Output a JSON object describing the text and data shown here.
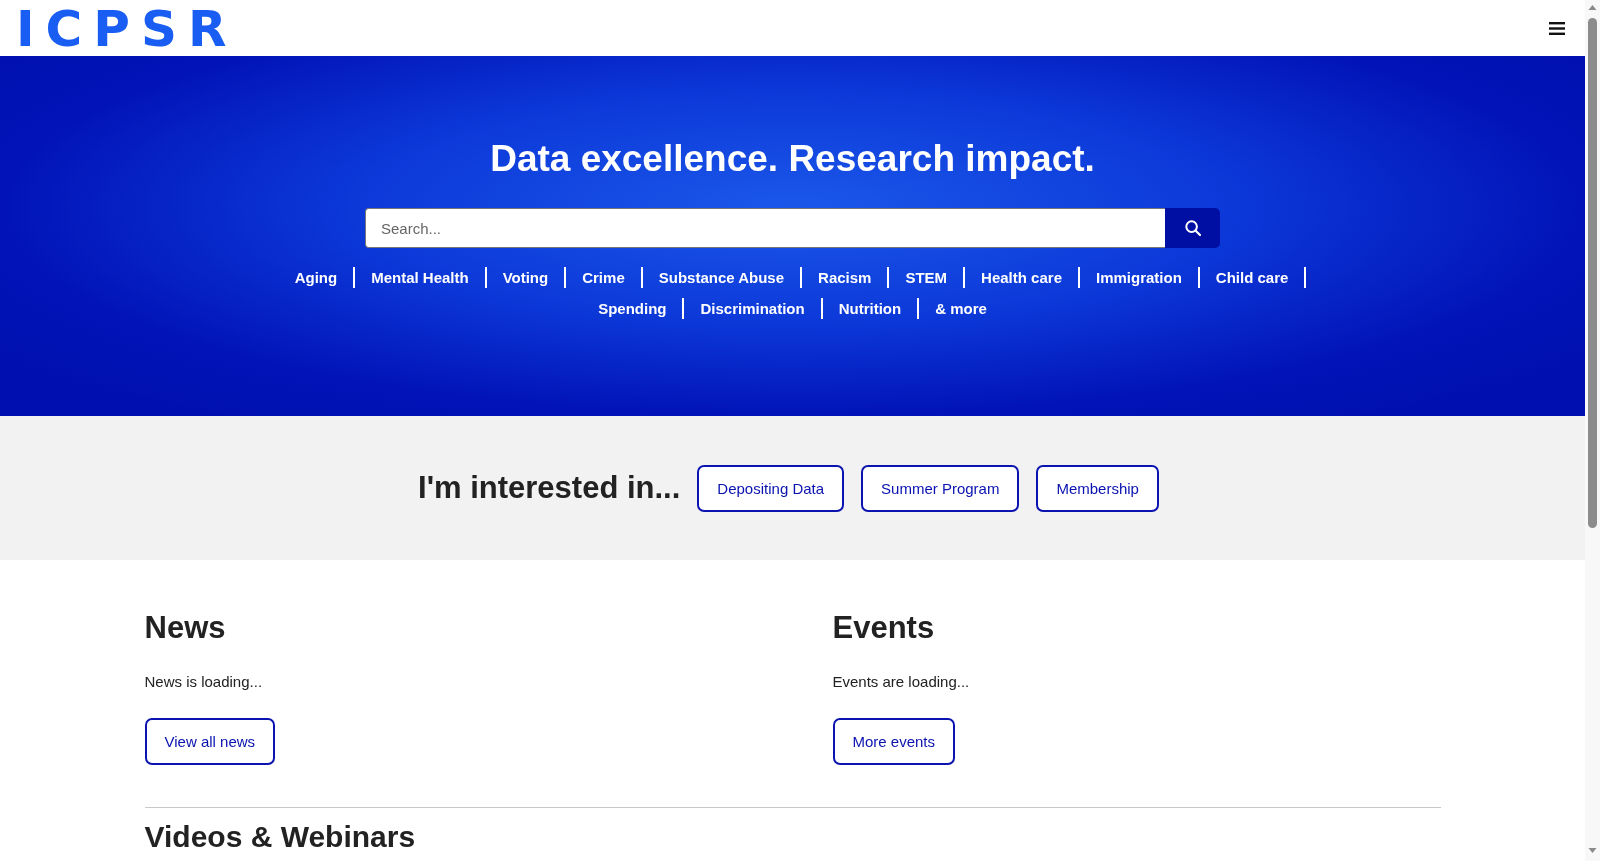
{
  "header": {
    "logo": "ICPSR"
  },
  "hero": {
    "title": "Data excellence. Research impact.",
    "search": {
      "placeholder": "Search..."
    },
    "topics": [
      "Aging",
      "Mental Health",
      "Voting",
      "Crime",
      "Substance Abuse",
      "Racism",
      "STEM",
      "Health care",
      "Immigration",
      "Child care",
      "Spending",
      "Discrimination",
      "Nutrition",
      "& more"
    ]
  },
  "interests": {
    "heading": "I'm interested in...",
    "buttons": [
      "Depositing Data",
      "Summer Program",
      "Membership"
    ]
  },
  "sections": [
    {
      "heading": "News",
      "status": "News is loading...",
      "button": "View all news"
    },
    {
      "heading": "Events",
      "status": "Events are loading...",
      "button": "More events"
    }
  ],
  "next_section": {
    "heading": "Videos & Webinars"
  }
}
